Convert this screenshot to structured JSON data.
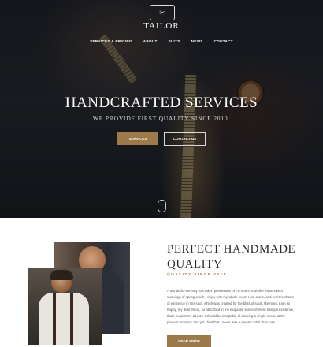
{
  "header": {
    "brand": "TAILOR",
    "nav": [
      "SERVICES & PRICING",
      "ABOUT",
      "SUITS",
      "NEWS",
      "CONTACT"
    ]
  },
  "hero": {
    "title": "HANDCRAFTED SERVICES",
    "subtitle": "WE PROVIDE FIRST QUALITY SINCE 2010.",
    "primary_button": "SERVICES",
    "secondary_button": "CONTACT US"
  },
  "about": {
    "title_line1": "PERFECT HANDMADE",
    "title_line2": "QUALITY",
    "subtitle": "QUALITY SINCE 2018",
    "body": "A wonderful serenity has taken possession of my entire soul, like these sweet mornings of spring which I enjoy with my whole heart. I am alone, and feel the charm of existence in this spot, which was created for the bliss of souls like mine. I am so happy, my dear friend, so absorbed in the exquisite sense of mere tranquil existence, that I neglect my talents. I should be incapable of drawing a single stroke at the present moment; and yet I feel that I never was a greater artist than now.",
    "button": "READ MORE"
  },
  "colors": {
    "accent": "#9c7a4a",
    "hero_bg": "#1b1d22",
    "text_dark": "#2a2a2a"
  },
  "icons": {
    "logo": "scissors-logo-icon",
    "scroll": "scroll-down-icon"
  }
}
